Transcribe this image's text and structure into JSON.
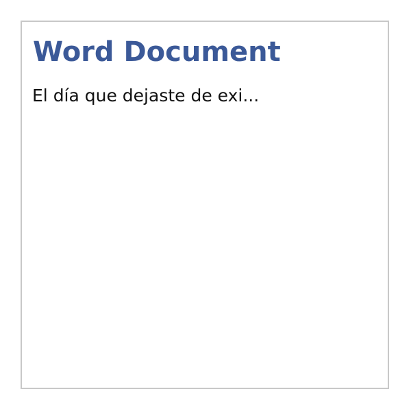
{
  "document_card": {
    "title": "Word Document",
    "preview_text": "El día que dejaste de exi...",
    "title_color": "#3b5998",
    "border_color": "#c8c8c8"
  }
}
